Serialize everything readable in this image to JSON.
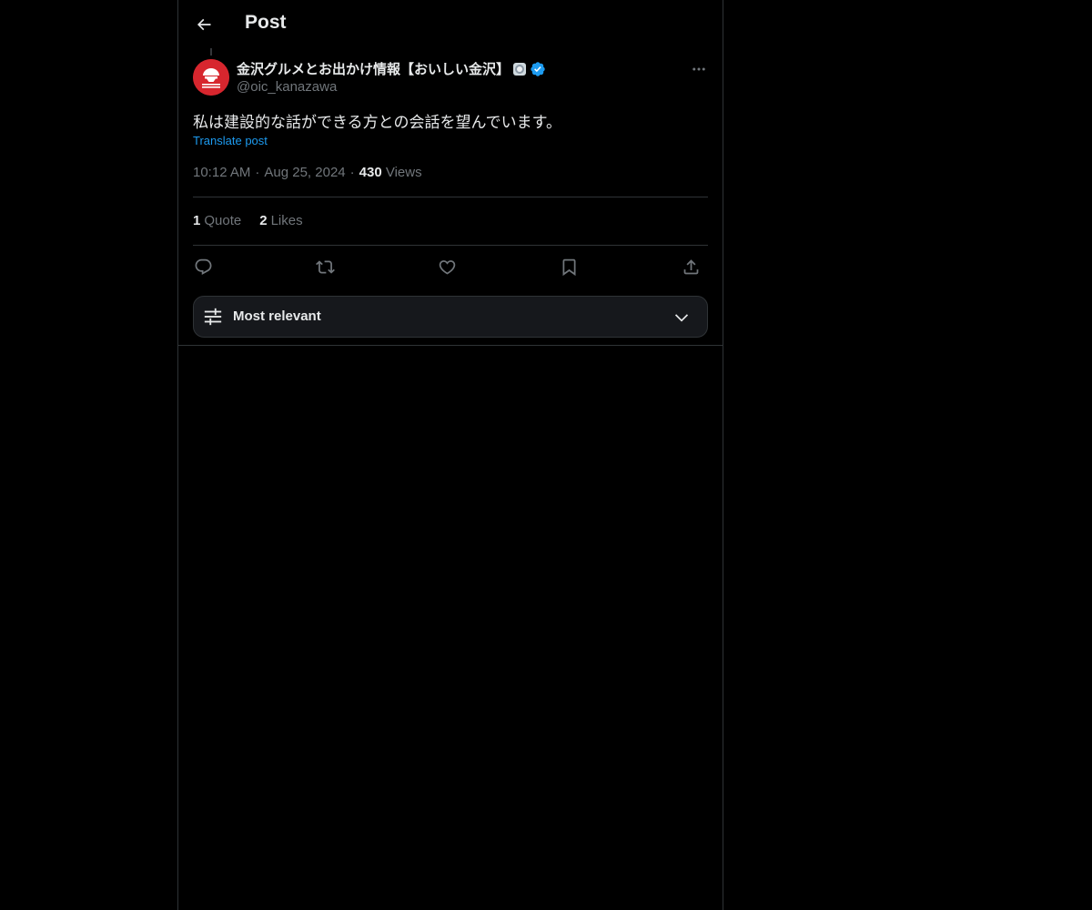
{
  "header": {
    "title": "Post",
    "back_icon": "arrow-left-icon"
  },
  "post": {
    "author": {
      "display_name": "金沢グルメとお出かけ情報【おいしい金沢】",
      "handle": "@oic_kanazawa",
      "verified": true,
      "avatar_color": "#d7262e"
    },
    "text": "私は建設的な話ができる方との会話を望んでいます。",
    "translate_label": "Translate post",
    "time": "10:12 AM",
    "date": "Aug 25, 2024",
    "views_count": "430",
    "views_label": "Views",
    "separator": "·"
  },
  "stats": {
    "quotes_count": "1",
    "quotes_label": "Quote",
    "likes_count": "2",
    "likes_label": "Likes"
  },
  "actions": [
    {
      "icon": "reply-icon"
    },
    {
      "icon": "repost-icon"
    },
    {
      "icon": "like-icon"
    },
    {
      "icon": "bookmark-icon"
    },
    {
      "icon": "share-icon"
    }
  ],
  "replies_sort": {
    "label": "Most relevant",
    "icon": "sliders-icon"
  },
  "colors": {
    "background": "#000000",
    "text": "#e7e9ea",
    "muted": "#71767b",
    "accent": "#1d9bf0",
    "border": "#2f3336"
  }
}
